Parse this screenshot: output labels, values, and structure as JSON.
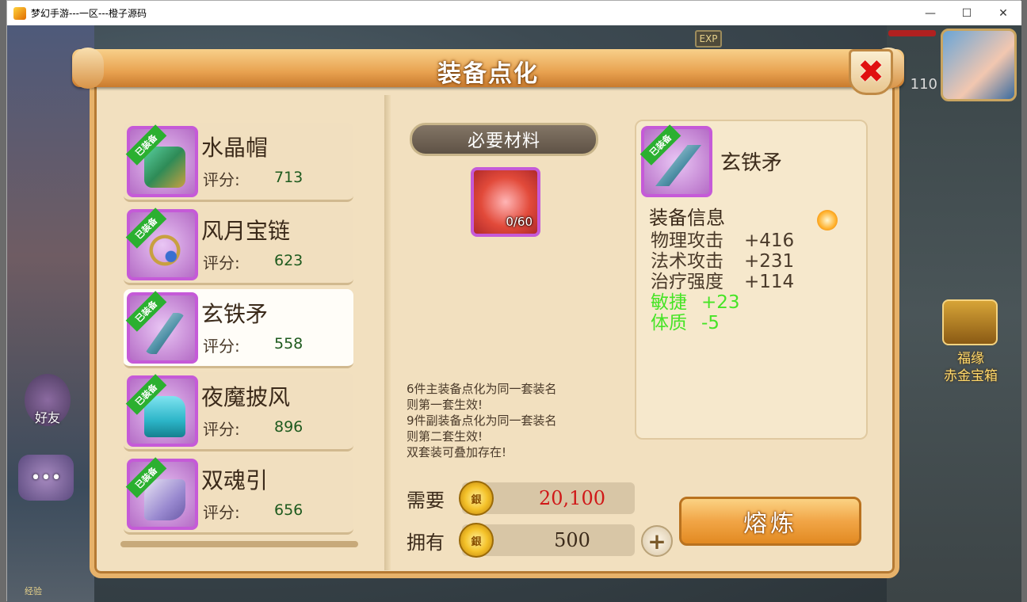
{
  "window": {
    "title": "梦幻手游---一区---橙子源码",
    "controls": [
      "—",
      "☐",
      "✕"
    ]
  },
  "hud": {
    "exp_badge": "EXP",
    "level": "110",
    "friends_label": "好友",
    "exp_label": "经验",
    "chest_label_1": "福缘",
    "chest_label_2": "赤金宝箱",
    "hp_color": "#b02020"
  },
  "panel": {
    "title": "装备点化",
    "close_icon": "close-icon"
  },
  "equipment_list": [
    {
      "name": "水晶帽",
      "score_label": "评分:",
      "score": "713",
      "tag": "已装备",
      "color": "#2e8b57"
    },
    {
      "name": "风月宝链",
      "score_label": "评分:",
      "score": "623",
      "tag": "已装备",
      "color": "#c8a040"
    },
    {
      "name": "玄铁矛",
      "score_label": "评分:",
      "score": "558",
      "tag": "已装备",
      "color": "#4e90a6"
    },
    {
      "name": "夜魔披风",
      "score_label": "评分:",
      "score": "896",
      "tag": "已装备",
      "color": "#2cb5c8"
    },
    {
      "name": "双魂引",
      "score_label": "评分:",
      "score": "656",
      "tag": "已装备",
      "color": "#9a8ad0"
    }
  ],
  "materials": {
    "header": "必要材料",
    "count": "0/60"
  },
  "notes": [
    "6件主装备点化为同一套装名",
    "则第一套生效!",
    "9件副装备点化为同一套装名",
    "则第二套生效!",
    "双套装可叠加存在!"
  ],
  "info": {
    "name": "玄铁矛",
    "tag": "已装备",
    "header": "装备信息",
    "stats": [
      {
        "k": "物理攻击",
        "v": "+416",
        "green": false
      },
      {
        "k": "法术攻击",
        "v": "+231",
        "green": false
      },
      {
        "k": "治疗强度",
        "v": "+114",
        "green": false
      },
      {
        "k": "敏捷",
        "v": "+23",
        "green": true
      },
      {
        "k": "体质",
        "v": "-5",
        "green": true
      }
    ]
  },
  "cost": {
    "need_label": "需要",
    "need_value": "20,100",
    "need_color": "#d01818",
    "have_label": "拥有",
    "have_value": "500",
    "have_color": "#3b2a1a",
    "plus_label": "+"
  },
  "smelt_button": "熔炼"
}
